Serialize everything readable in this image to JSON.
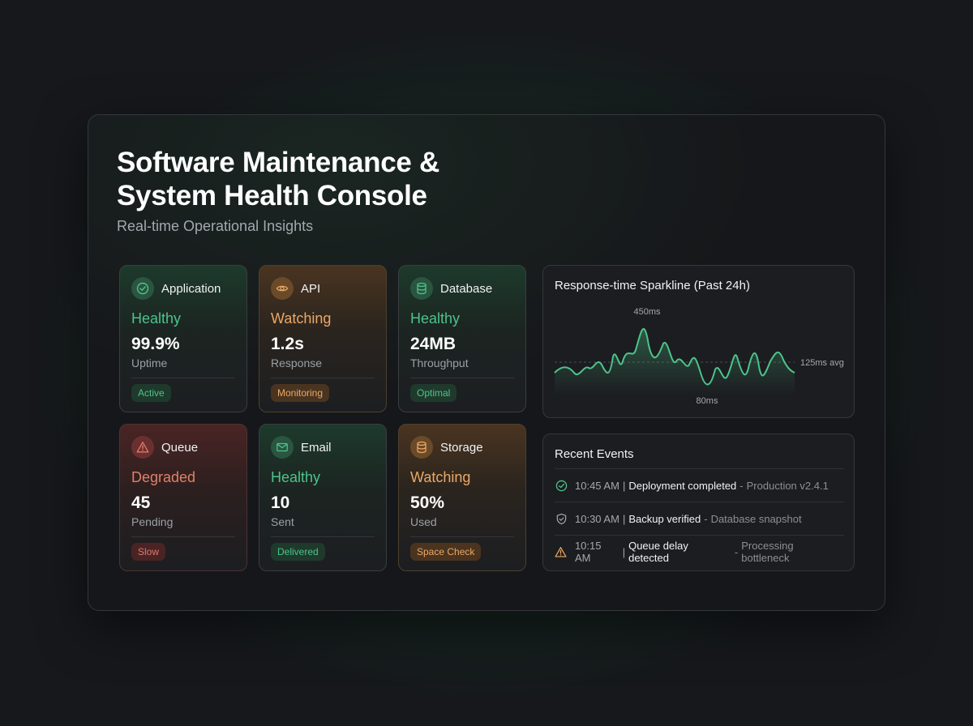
{
  "header": {
    "title": "Software Maintenance & System Health Console",
    "subtitle": "Real-time Operational Insights"
  },
  "cards": [
    {
      "name": "Application",
      "icon": "check-circle-icon",
      "tone": "green",
      "status": "Healthy",
      "value": "99.9%",
      "label": "Uptime",
      "badge": "Active"
    },
    {
      "name": "API",
      "icon": "eye-icon",
      "tone": "orange",
      "status": "Watching",
      "value": "1.2s",
      "label": "Response",
      "badge": "Monitoring"
    },
    {
      "name": "Database",
      "icon": "database-icon",
      "tone": "green",
      "status": "Healthy",
      "value": "24MB",
      "label": "Throughput",
      "badge": "Optimal"
    },
    {
      "name": "Queue",
      "icon": "warning-icon",
      "tone": "red",
      "status": "Degraded",
      "value": "45",
      "label": "Pending",
      "badge": "Slow"
    },
    {
      "name": "Email",
      "icon": "mail-icon",
      "tone": "green",
      "status": "Healthy",
      "value": "10",
      "label": "Sent",
      "badge": "Delivered"
    },
    {
      "name": "Storage",
      "icon": "database-icon",
      "tone": "orange",
      "status": "Watching",
      "value": "50%",
      "label": "Used",
      "badge": "Space Check"
    }
  ],
  "sparkline": {
    "title": "Response-time Sparkline (Past 24h)",
    "max_label": "450ms",
    "min_label": "80ms",
    "avg_label": "125ms avg",
    "accent": "#4cc48a"
  },
  "events": {
    "title": "Recent Events",
    "items": [
      {
        "icon": "check-circle-icon",
        "time": "10:45 AM",
        "title": "Deployment completed",
        "detail": "Production v2.4.1"
      },
      {
        "icon": "shield-check-icon",
        "time": "10:30 AM",
        "title": "Backup verified",
        "detail": "Database snapshot"
      },
      {
        "icon": "warning-icon",
        "time": "10:15 AM",
        "title": "Queue delay detected",
        "detail": "Processing bottleneck"
      }
    ]
  },
  "colors": {
    "healthy": "#4cc48a",
    "watching": "#eaa866",
    "degraded": "#e08068",
    "background": "#16181b"
  }
}
